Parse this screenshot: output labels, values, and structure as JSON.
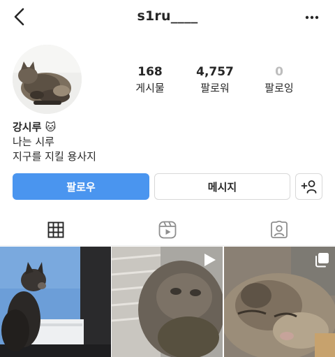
{
  "header": {
    "username": "s1ru____",
    "back_icon": "chevron-left-icon",
    "more_icon": "more-horizontal-icon"
  },
  "profile": {
    "avatar_icon": "profile-avatar"
  },
  "stats": [
    {
      "value": "168",
      "label": "게시물"
    },
    {
      "value": "4,757",
      "label": "팔로워"
    },
    {
      "value": "0",
      "label": "팔로잉"
    }
  ],
  "bio": {
    "name": "강시루 🐱",
    "line1": "나는 시루",
    "line2": "지구를 지킬 용사지"
  },
  "actions": {
    "follow_label": "팔로우",
    "message_label": "메시지",
    "add_user_icon": "add-user-icon"
  },
  "tabs": [
    {
      "icon": "grid-icon",
      "active": true
    },
    {
      "icon": "reels-icon",
      "active": false
    },
    {
      "icon": "tagged-icon",
      "active": false
    }
  ],
  "posts": [
    {
      "type": "photo"
    },
    {
      "type": "reel",
      "badge_icon": "play-icon"
    },
    {
      "type": "carousel",
      "badge_icon": "carousel-icon"
    }
  ],
  "colors": {
    "accent": "#4a95ef",
    "text": "#262626",
    "border": "#d8d8d8"
  }
}
